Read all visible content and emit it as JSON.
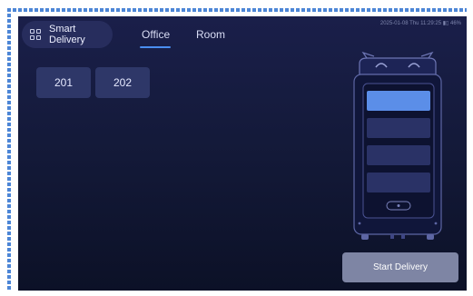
{
  "app": {
    "name_line1": "Smart",
    "name_line2": "Delivery"
  },
  "tabs": [
    {
      "label": "Office",
      "active": true
    },
    {
      "label": "Room",
      "active": false
    }
  ],
  "status_bar": {
    "text": "2025-01-08 Thu 11:29:25  ▮▯  46%"
  },
  "rooms": [
    {
      "label": "201"
    },
    {
      "label": "202"
    }
  ],
  "robot": {
    "trays": 4,
    "selected_tray_index": 0
  },
  "actions": {
    "start_label": "Start Delivery"
  },
  "colors": {
    "accent": "#4a8ef0",
    "background": "#141a3a",
    "selected_tray": "#5b8ee8",
    "button": "#7e85a4"
  },
  "icons": {
    "app": "grid-icon",
    "robot": "delivery-robot-illustration"
  }
}
